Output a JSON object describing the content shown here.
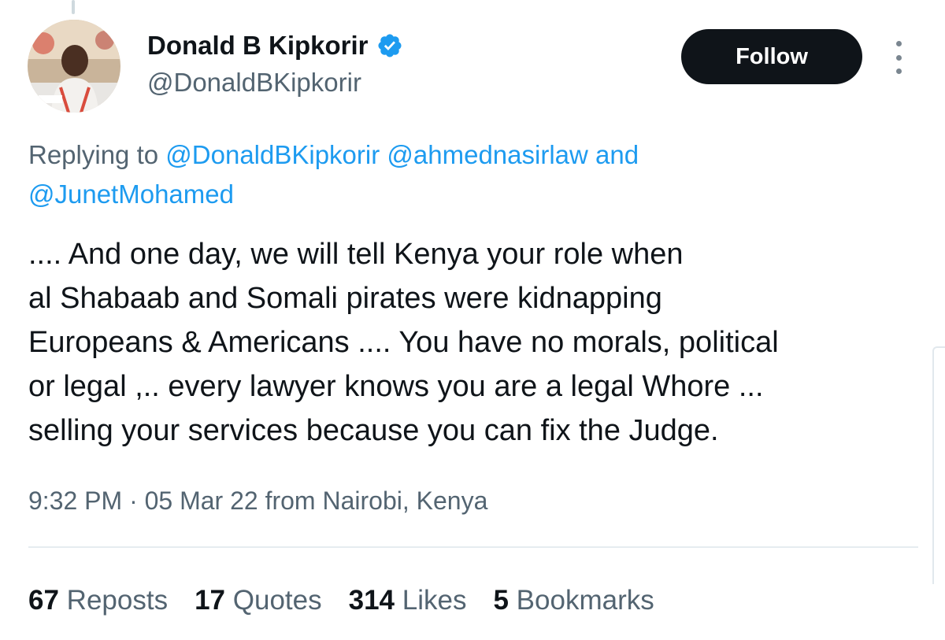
{
  "author": {
    "display_name": "Donald B Kipkorir",
    "handle": "@DonaldBKipkorir",
    "verified": true
  },
  "actions": {
    "follow_label": "Follow"
  },
  "reply_context": {
    "prefix": "Replying to",
    "mentions": [
      "@DonaldBKipkorir",
      "@ahmednasirlaw"
    ],
    "conjunction": "and",
    "last_mention": "@JunetMohamed"
  },
  "tweet": {
    "text": ".... And one day, we will tell Kenya your role when\nal Shabaab and Somali pirates were kidnapping\nEuropeans & Americans .... You have no morals, political\nor legal  ,.. every lawyer knows you are a legal Whore ...\nselling your services because you can fix the Judge.",
    "time": "9:32 PM",
    "separator": "·",
    "date_location": "05 Mar 22 from Nairobi, Kenya"
  },
  "stats": [
    {
      "count": "67",
      "label": "Reposts"
    },
    {
      "count": "17",
      "label": "Quotes"
    },
    {
      "count": "314",
      "label": "Likes"
    },
    {
      "count": "5",
      "label": "Bookmarks"
    }
  ],
  "colors": {
    "accent": "#1d9bf0",
    "text_primary": "#0f1419",
    "text_secondary": "#536471",
    "follow_bg": "#0f1419"
  },
  "icons": {
    "verified": "verified-badge-icon",
    "more": "more-vertical-icon"
  }
}
